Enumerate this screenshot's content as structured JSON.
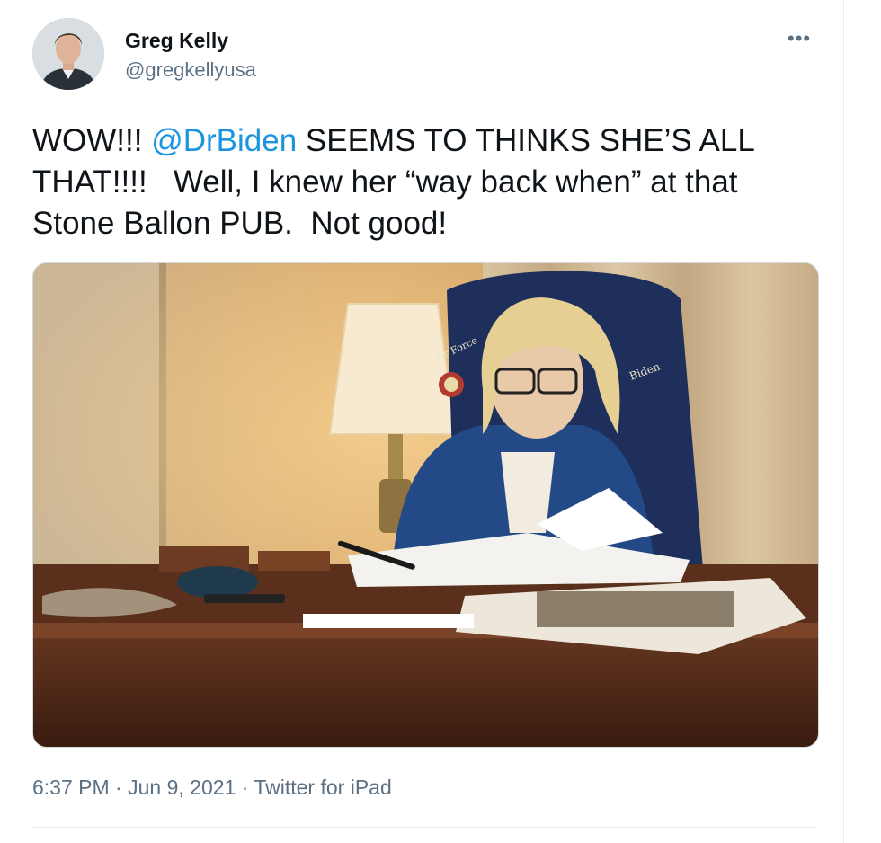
{
  "user": {
    "name": "Greg Kelly",
    "handle": "@gregkellyusa",
    "avatar_icon": "person-avatar-icon"
  },
  "menu": {
    "more_label": "•••"
  },
  "tweet": {
    "text_before": "WOW!!! ",
    "mention": "@DrBiden",
    "text_after": " SEEMS TO THINKS SHE’S ALL THAT!!!!   Well, I knew her “way back when” at that Stone Ballon PUB.  Not good!"
  },
  "media": {
    "jacket_text_left": "Air Force",
    "jacket_text_right": "Biden"
  },
  "meta": {
    "time": "6:37 PM",
    "sep1": " · ",
    "date": "Jun 9, 2021",
    "sep2": " · ",
    "source": "Twitter for iPad"
  },
  "colors": {
    "link": "#1b95e0",
    "secondary_text": "#5b7083",
    "divider": "#e6ecf0"
  }
}
